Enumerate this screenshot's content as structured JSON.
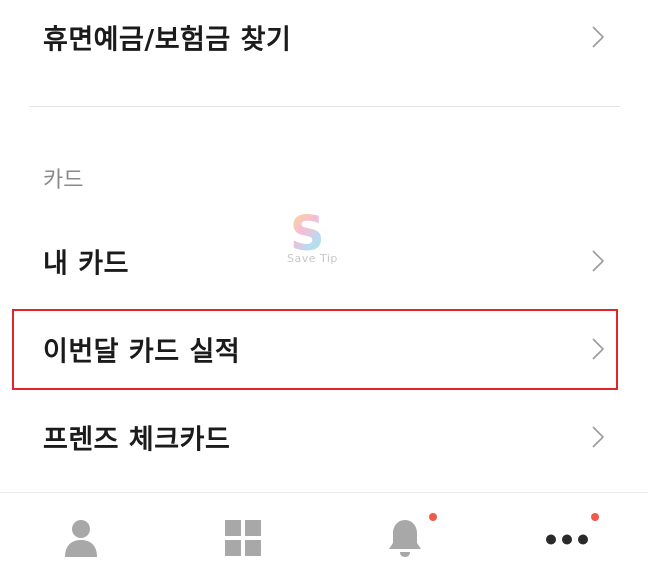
{
  "menu": {
    "dormant_deposit": {
      "label": "휴면예금/보험금 찾기"
    },
    "card_section": {
      "title": "카드",
      "items": [
        {
          "label": "내 카드"
        },
        {
          "label": "이번달 카드 실적",
          "highlighted": true
        },
        {
          "label": "프렌즈 체크카드"
        }
      ]
    }
  },
  "watermark": {
    "text": "Save Tip"
  },
  "bottom_nav": {
    "items": [
      {
        "icon": "person-icon",
        "badge": false
      },
      {
        "icon": "grid-icon",
        "badge": false
      },
      {
        "icon": "bell-icon",
        "badge": true
      },
      {
        "icon": "more-icon",
        "badge": true
      }
    ],
    "badge_color": "#ef5a4a"
  },
  "colors": {
    "highlight_border": "#e0262a",
    "text_primary": "#1b1b1b",
    "text_secondary": "#8a8a8a",
    "icon": "#a8a8a8"
  }
}
